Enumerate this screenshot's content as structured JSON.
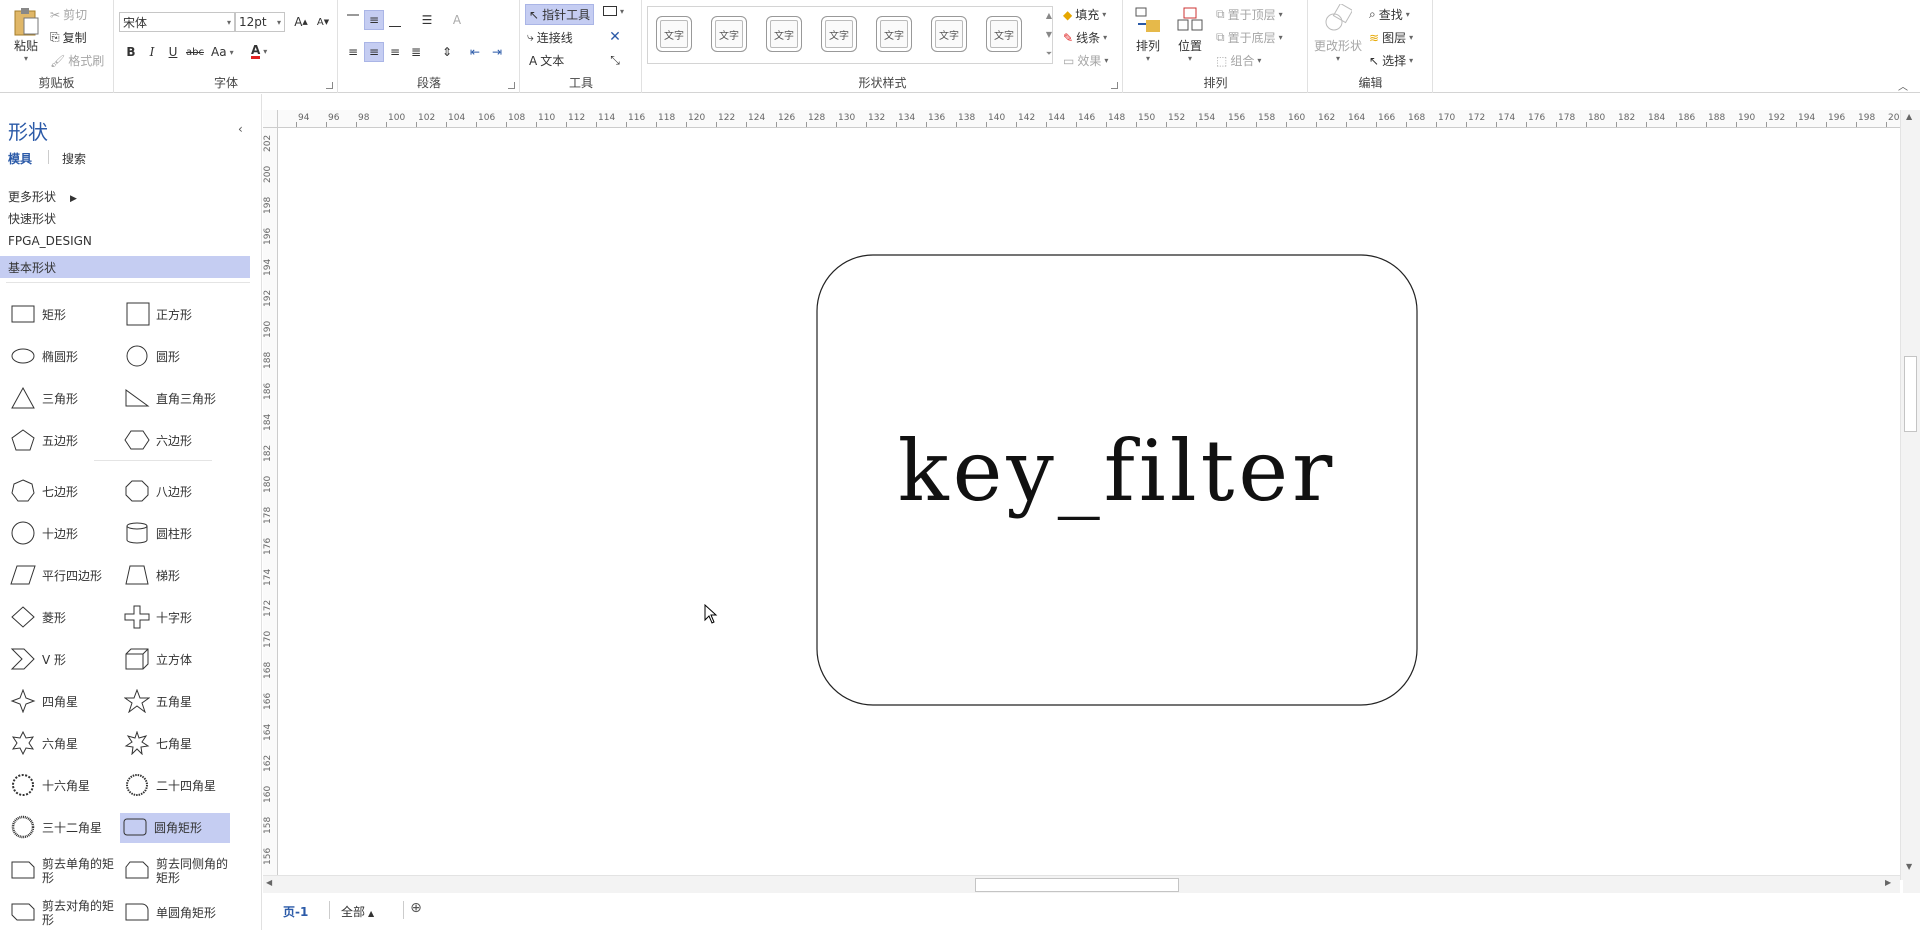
{
  "ribbon": {
    "clipboard": {
      "paste": "粘贴",
      "cut": "剪切",
      "copy": "复制",
      "format_painter": "格式刷",
      "label": "剪贴板"
    },
    "font": {
      "font_name": "宋体",
      "font_size": "12pt",
      "bold": "B",
      "italic": "I",
      "underline": "U",
      "strike": "abc",
      "case": "Aa",
      "color_letter": "A",
      "grow": "A",
      "shrink": "A",
      "label": "字体"
    },
    "paragraph": {
      "label": "段落"
    },
    "tools": {
      "pointer": "指针工具",
      "connector": "连接线",
      "text": "文本",
      "label": "工具"
    },
    "shape_styles": {
      "sample": "文字",
      "count": 7,
      "label": "形状样式",
      "fill": "填充",
      "line": "线条",
      "effect": "效果"
    },
    "arrange": {
      "arrange": "排列",
      "position": "位置",
      "bring_front": "置于顶层",
      "send_back": "置于底层",
      "group": "组合",
      "label": "排列"
    },
    "edit": {
      "change_shape": "更改形状",
      "find": "查找",
      "layers": "图层",
      "select": "选择",
      "label": "编辑"
    }
  },
  "panel": {
    "title": "形状",
    "tab_stencil": "模具",
    "tab_search": "搜索",
    "nav": [
      "更多形状",
      "快速形状",
      "FPGA_DESIGN",
      "基本形状"
    ],
    "shapes": [
      [
        "矩形",
        "正方形"
      ],
      [
        "椭圆形",
        "圆形"
      ],
      [
        "三角形",
        "直角三角形"
      ],
      [
        "五边形",
        "六边形"
      ],
      [
        "七边形",
        "八边形"
      ],
      [
        "十边形",
        "圆柱形"
      ],
      [
        "平行四边形",
        "梯形"
      ],
      [
        "菱形",
        "十字形"
      ],
      [
        "V 形",
        "立方体"
      ],
      [
        "四角星",
        "五角星"
      ],
      [
        "六角星",
        "七角星"
      ],
      [
        "十六角星",
        "二十四角星"
      ],
      [
        "三十二角星",
        "圆角矩形"
      ],
      [
        "剪去单角的矩形",
        "剪去同侧角的矩形"
      ],
      [
        "剪去对角的矩形",
        "单圆角矩形"
      ]
    ]
  },
  "rulers": {
    "h": [
      "94",
      "96",
      "98",
      "100",
      "102",
      "104",
      "106",
      "108",
      "110",
      "112",
      "114",
      "116",
      "118",
      "120",
      "122",
      "124",
      "126",
      "128",
      "130",
      "132",
      "134",
      "136",
      "138",
      "140",
      "142",
      "144",
      "146",
      "148",
      "150",
      "152",
      "154",
      "156",
      "158",
      "160",
      "162",
      "164",
      "166",
      "168",
      "170",
      "172",
      "174",
      "176",
      "178",
      "180",
      "182",
      "184",
      "186",
      "188",
      "190",
      "192",
      "194",
      "196",
      "198",
      "20"
    ],
    "v": [
      "202",
      "200",
      "198",
      "196",
      "194",
      "192",
      "190",
      "188",
      "186",
      "184",
      "182",
      "180",
      "178",
      "176",
      "174",
      "172",
      "170",
      "168",
      "166",
      "164",
      "162",
      "160",
      "158",
      "156"
    ]
  },
  "canvas": {
    "shape_text": "key_filter"
  },
  "page_tabs": {
    "page1": "页-1",
    "all": "全部"
  }
}
